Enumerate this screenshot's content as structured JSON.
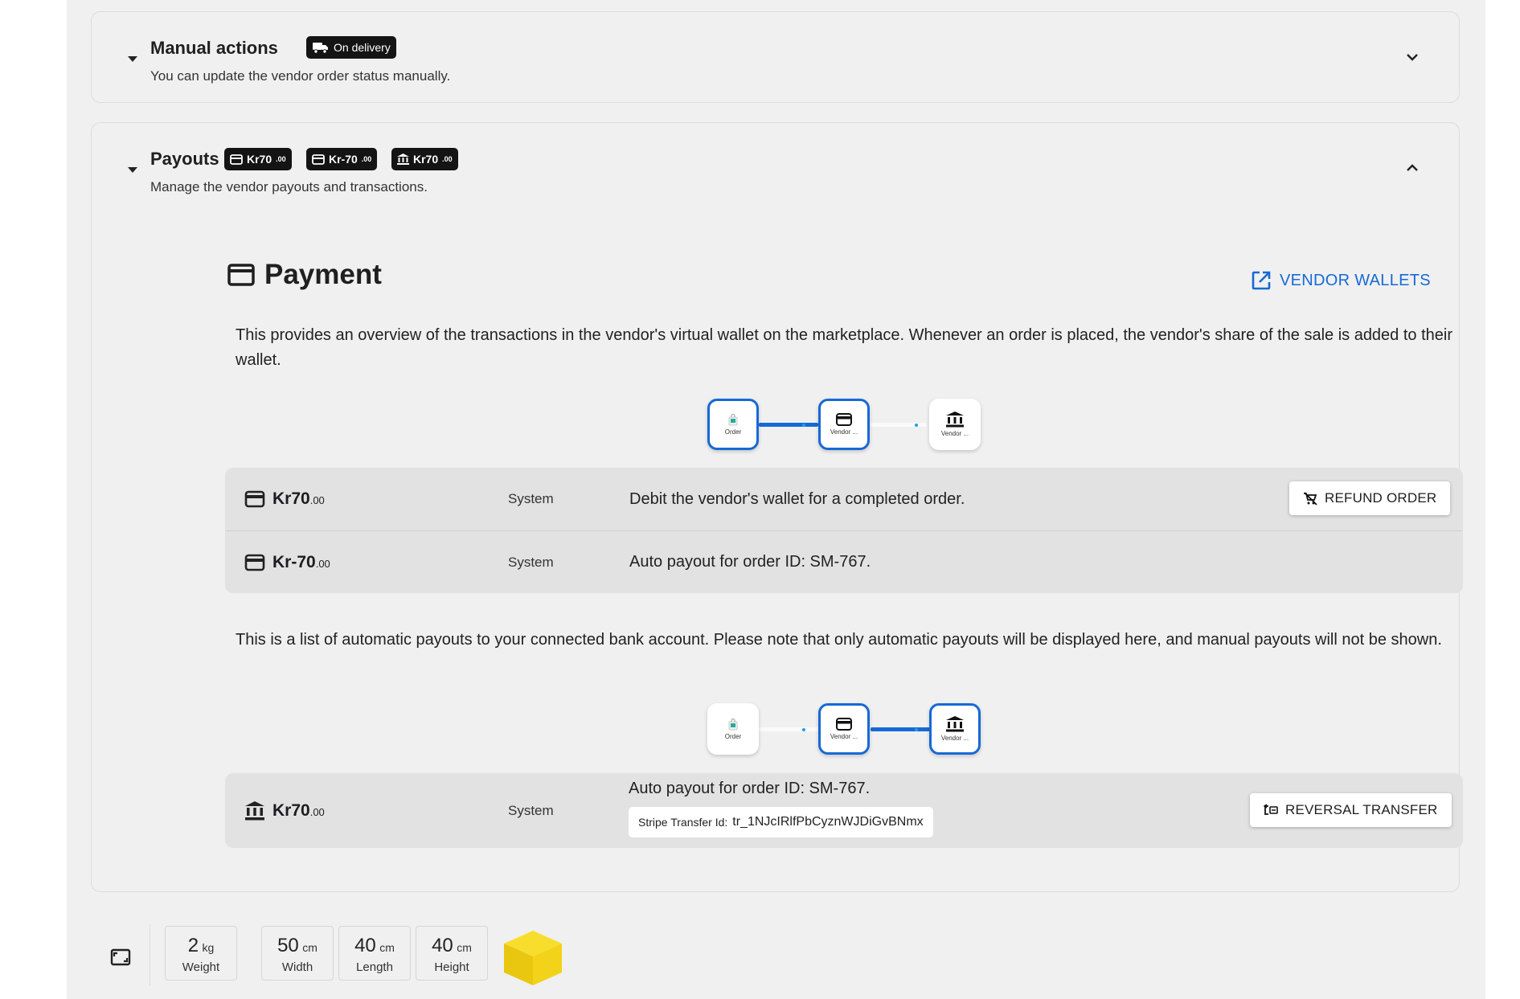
{
  "manual": {
    "title": "Manual actions",
    "badge": "On delivery",
    "subtitle": "You can update the vendor order status manually."
  },
  "payouts": {
    "title": "Payouts",
    "chips": [
      {
        "icon": "wallet-icon",
        "amount": "Kr70",
        "decimals": ".00"
      },
      {
        "icon": "wallet-icon",
        "amount": "Kr-70",
        "decimals": ".00"
      },
      {
        "icon": "bank-icon",
        "amount": "Kr70",
        "decimals": ".00"
      }
    ],
    "subtitle": "Manage the vendor payouts and transactions."
  },
  "payment": {
    "title": "Payment",
    "vendor_wallets_label": "VENDOR WALLETS",
    "wallet_desc": "This provides an overview of the transactions in the vendor's virtual wallet on the marketplace. Whenever an order is placed, the vendor's share of the sale is added to their wallet.",
    "payout_desc": "This is a list of automatic payouts to your connected bank account. Please note that only automatic payouts will be displayed here, and manual payouts will not be shown."
  },
  "flow": {
    "order_label": "Order",
    "wallet_label": "Vendor ...",
    "bank_label": "Vendor ..."
  },
  "wallet_transactions": [
    {
      "icon": "wallet-icon",
      "amount": "Kr70",
      "decimals": ".00",
      "by": "System",
      "description": "Debit the vendor's wallet for a completed order.",
      "action": "REFUND ORDER"
    },
    {
      "icon": "wallet-icon",
      "amount": "Kr-70",
      "decimals": ".00",
      "by": "System",
      "description": "Auto payout for order ID: SM-767."
    }
  ],
  "bank_transactions": [
    {
      "icon": "bank-icon",
      "amount": "Kr70",
      "decimals": ".00",
      "by": "System",
      "description": "Auto payout for order ID: SM-767.",
      "stripe_label": "Stripe Transfer Id:",
      "stripe_id": "tr_1NJcIRlfPbCyznWJDiGvBNmx",
      "action": "REVERSAL TRANSFER"
    }
  ],
  "dimensions": [
    {
      "value": "2",
      "unit": "kg",
      "label": "Weight"
    },
    {
      "value": "50",
      "unit": "cm",
      "label": "Width"
    },
    {
      "value": "40",
      "unit": "cm",
      "label": "Length"
    },
    {
      "value": "40",
      "unit": "cm",
      "label": "Height"
    }
  ],
  "colors": {
    "accent": "#1769d6",
    "chip": "#141414",
    "box": "#f5d312"
  }
}
